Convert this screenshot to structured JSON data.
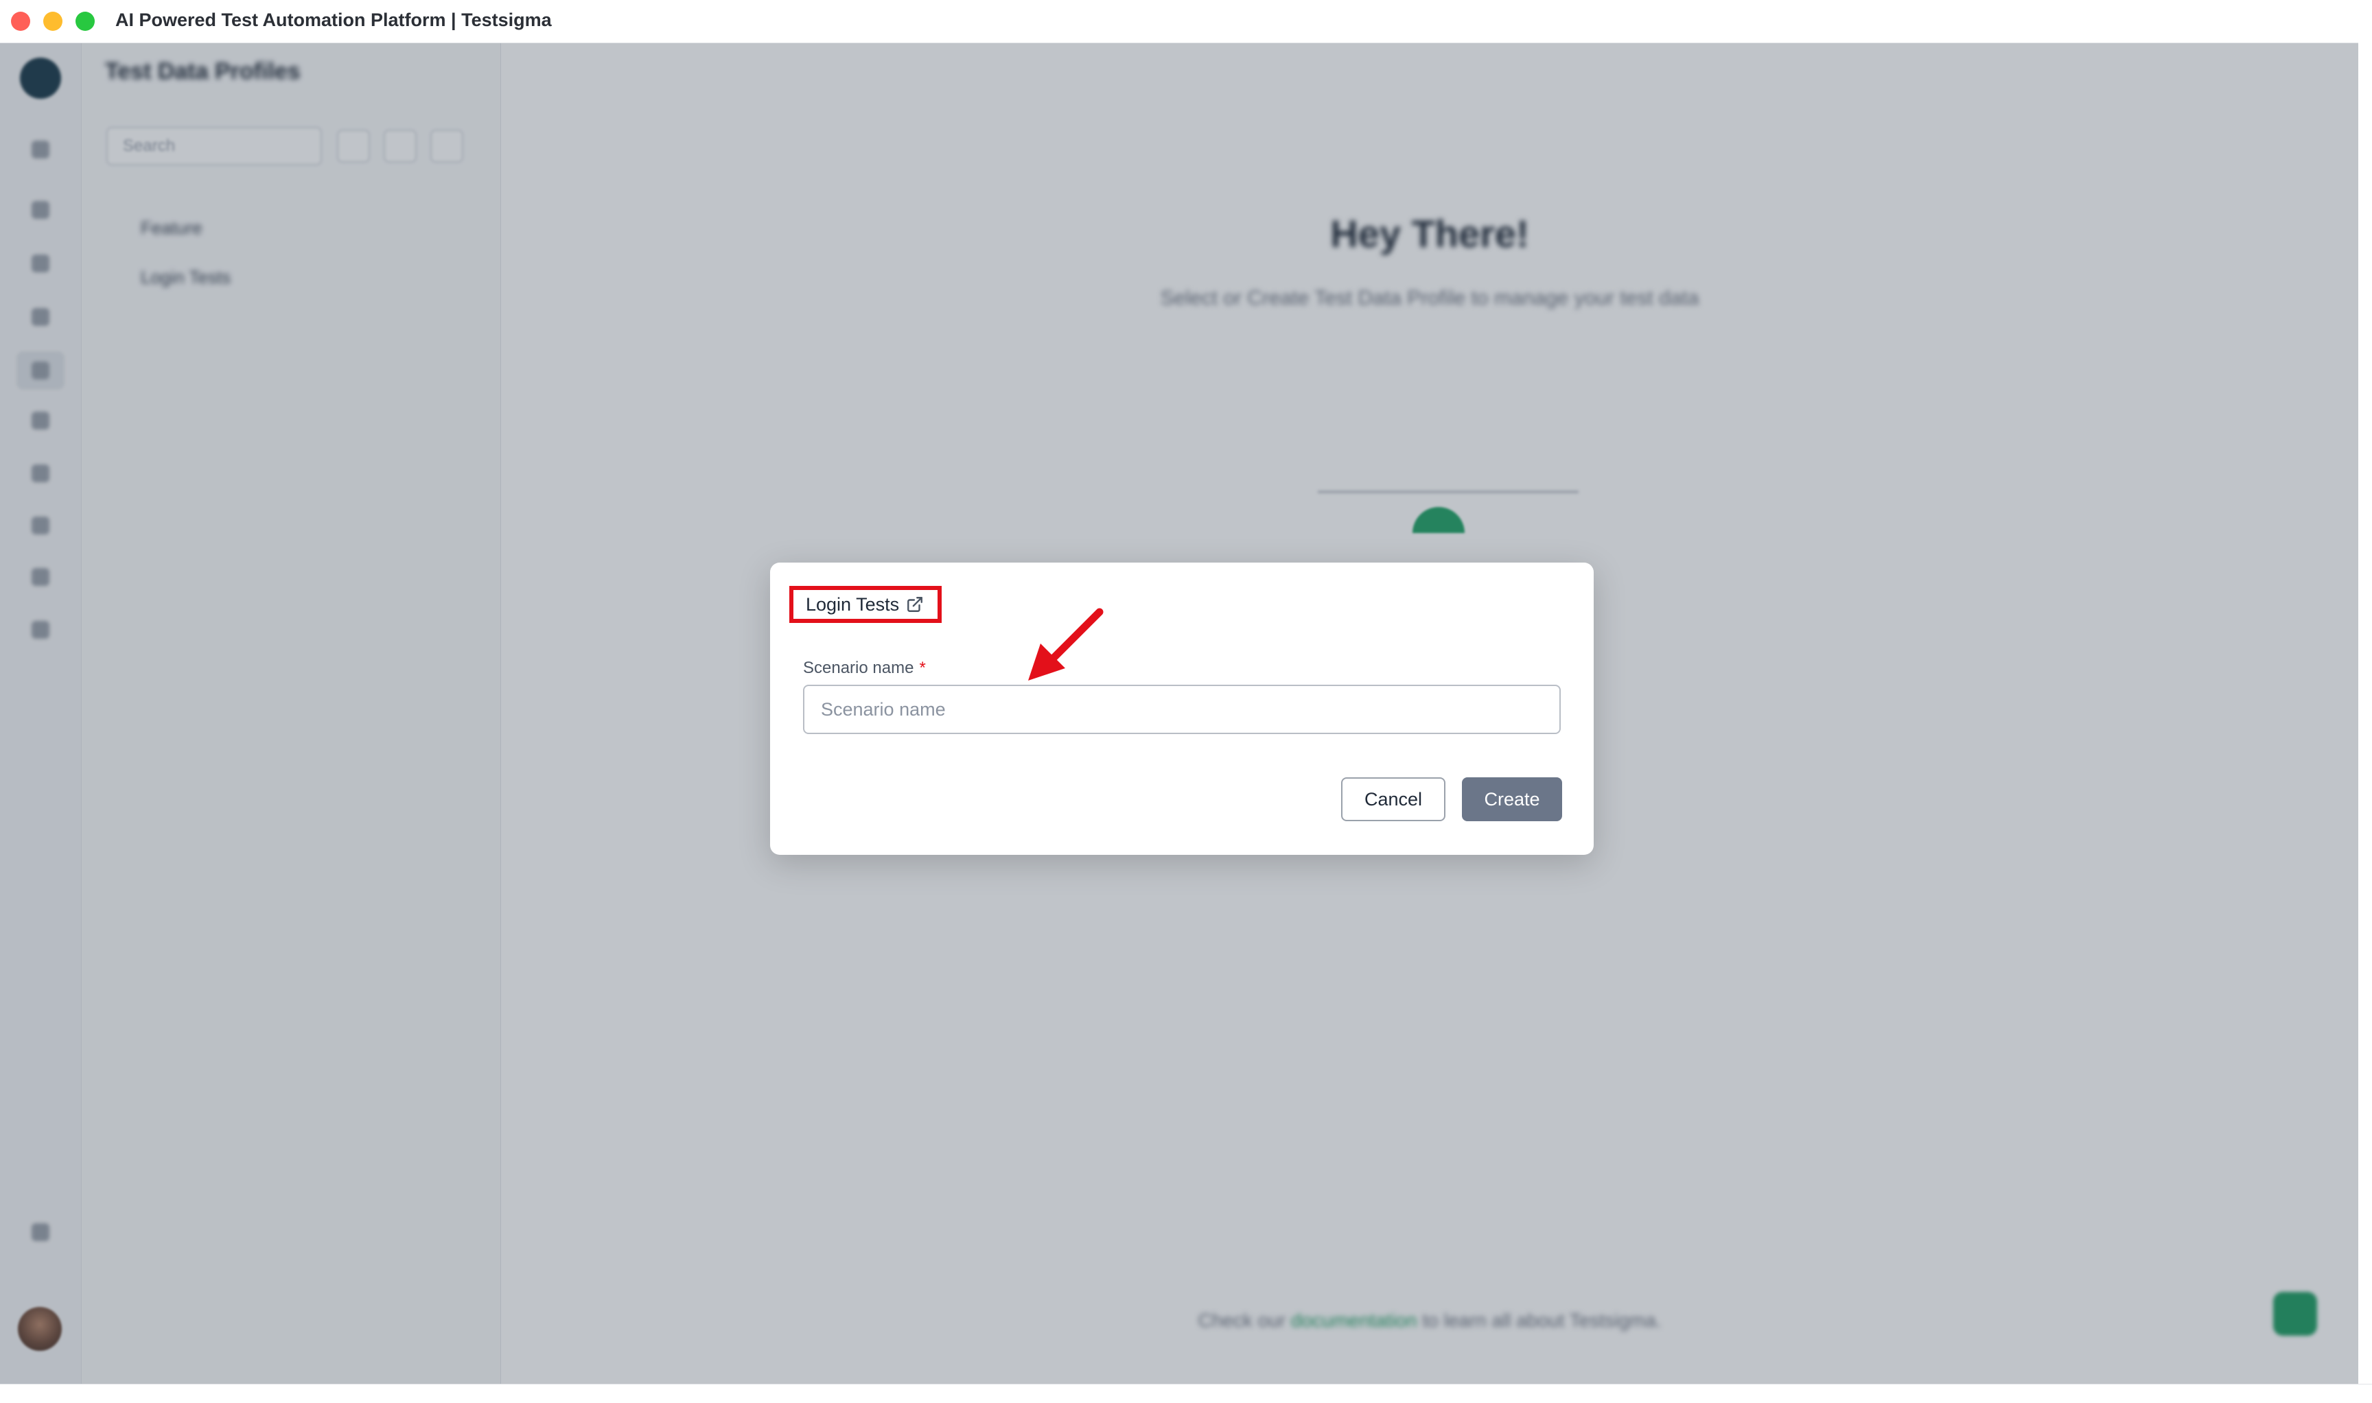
{
  "window": {
    "title": "AI Powered Test Automation Platform | Testsigma"
  },
  "sidebar": {
    "pane_title": "Test Data Profiles",
    "search_placeholder": "Search",
    "tree": [
      {
        "label": "Feature"
      },
      {
        "label": "Login Tests"
      }
    ]
  },
  "main": {
    "heading": "Hey There!",
    "subheading": "Select or Create Test Data Profile to manage your test data",
    "footer_prefix": "Check our",
    "footer_link": "documentation",
    "footer_suffix": "to learn all about Testsigma."
  },
  "modal": {
    "breadcrumb": "Login Tests",
    "breadcrumb_icon": "external-link-icon",
    "field_label": "Scenario name",
    "required_marker": "*",
    "field_placeholder": "Scenario name",
    "field_value": "",
    "cancel_label": "Cancel",
    "create_label": "Create"
  },
  "annotations": {
    "highlight_color": "#e3101a",
    "arrow_color": "#e3101a"
  },
  "colors": {
    "primary_button": "#6b7689",
    "accent_green": "#1f9d63"
  }
}
